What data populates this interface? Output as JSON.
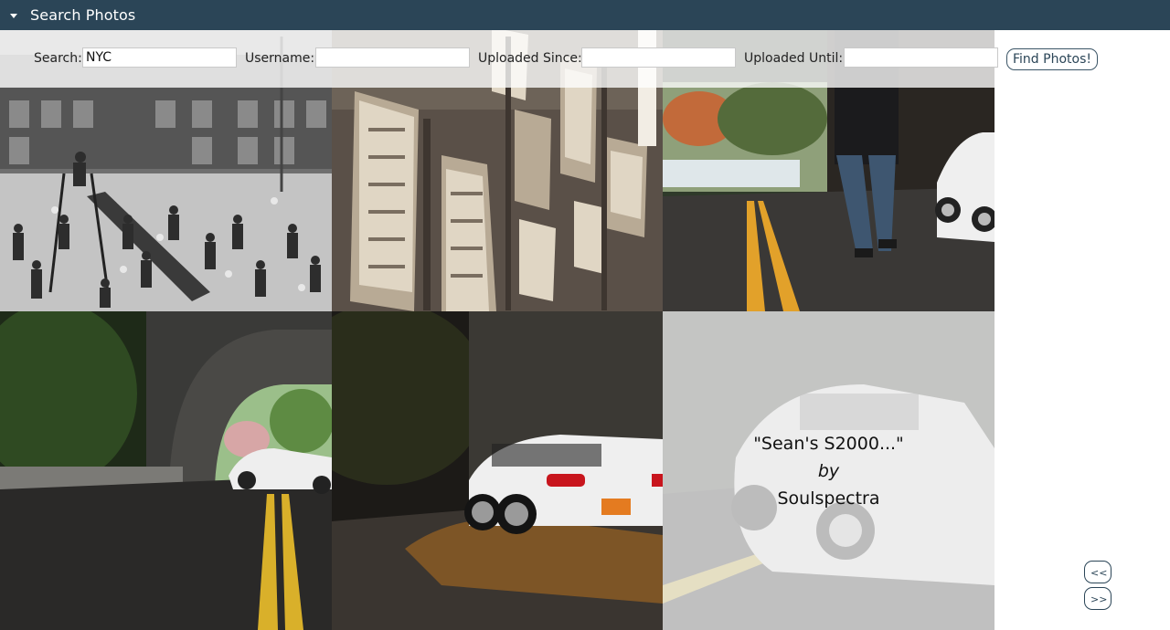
{
  "header": {
    "title": "Search Photos"
  },
  "search": {
    "search_label": "Search:",
    "search_value": "NYC",
    "username_label": "Username:",
    "username_value": "",
    "since_label": "Uploaded Since:",
    "since_value": "",
    "until_label": "Uploaded Until:",
    "until_value": "",
    "button_label": "Find Photos!"
  },
  "overlay": {
    "title": "\"Sean's S2000...\"",
    "by": "by",
    "author": "Soulspectra"
  },
  "pagination": {
    "prev_label": "<<",
    "next_label": ">>"
  },
  "colors": {
    "header_bg": "#2b4557",
    "accent": "#2b4557"
  }
}
